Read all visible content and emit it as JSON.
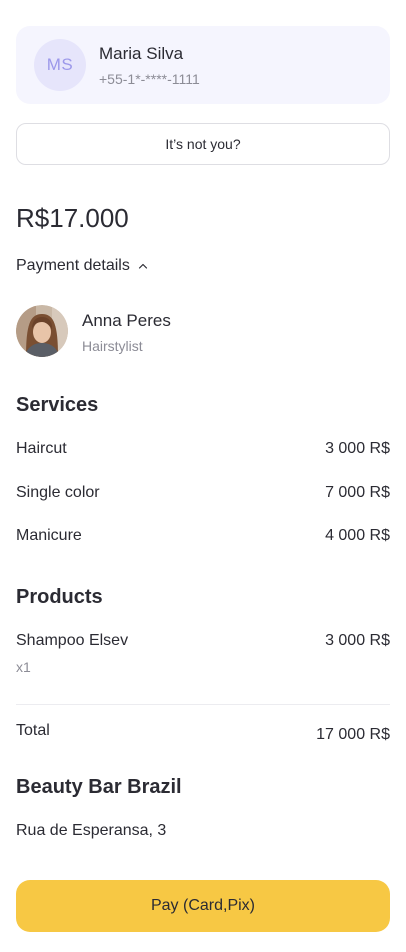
{
  "user": {
    "initials": "MS",
    "name": "Maria Silva",
    "phone": "+55-1*-****-1111"
  },
  "not_you_label": "It’s not you?",
  "amount": "R$17.000",
  "payment_details_label": "Payment details",
  "stylist": {
    "name": "Anna Peres",
    "role": "Hairstylist"
  },
  "services": {
    "title": "Services",
    "items": [
      {
        "name": "Haircut",
        "price": "3 000 R$"
      },
      {
        "name": "Single color",
        "price": "7 000 R$"
      },
      {
        "name": "Manicure",
        "price": "4 000 R$"
      }
    ]
  },
  "products": {
    "title": "Products",
    "items": [
      {
        "name": "Shampoo Elsev",
        "qty": "x1",
        "price": "3 000 R$"
      }
    ]
  },
  "total": {
    "label": "Total",
    "value": "17 000 R$"
  },
  "salon": {
    "name": "Beauty Bar Brazil",
    "address": "Rua de Esperansa, 3"
  },
  "pay_button_label": "Pay (Card,Pix)",
  "colors": {
    "accent": "#f7c844",
    "card_bg": "#f5f5fe",
    "avatar_bg": "#e6e5fb",
    "avatar_text": "#9c98ea",
    "muted_text": "#8c8c96"
  }
}
